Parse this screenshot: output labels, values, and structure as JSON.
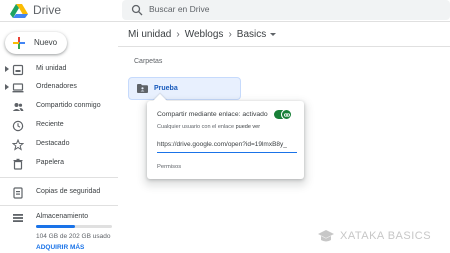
{
  "app": {
    "name": "Drive"
  },
  "search": {
    "placeholder": "Buscar en Drive"
  },
  "sidebar": {
    "new_label": "Nuevo",
    "items": [
      {
        "label": "Mi unidad",
        "icon": "drive-icon"
      },
      {
        "label": "Ordenadores",
        "icon": "computer-icon"
      },
      {
        "label": "Compartido conmigo",
        "icon": "people-icon"
      },
      {
        "label": "Reciente",
        "icon": "clock-icon"
      },
      {
        "label": "Destacado",
        "icon": "star-icon"
      },
      {
        "label": "Papelera",
        "icon": "trash-icon"
      },
      {
        "label": "Copias de seguridad",
        "icon": "backup-icon"
      },
      {
        "label": "Almacenamiento",
        "icon": "storage-icon"
      }
    ],
    "storage": {
      "usage_text": "104 GB de 202 GB usado",
      "used_fraction": 0.515,
      "link": "ADQUIRIR MÁS"
    }
  },
  "breadcrumb": [
    "Mi unidad",
    "Weblogs",
    "Basics"
  ],
  "section": {
    "title": "Carpetas"
  },
  "folder": {
    "name": "Prueba"
  },
  "share_popup": {
    "title": "Compartir mediante enlace: activado",
    "sub_prefix": "Cualquier usuario con el enlace",
    "sub_permission": "puede ver",
    "url": "https://drive.google.com/open?id=19lmxB8y_",
    "permissions_label": "Permisos",
    "toggle_on": true
  },
  "watermark": {
    "text": "XATAKA BASICS"
  },
  "colors": {
    "accent": "#1a73e8",
    "toggle": "#188038",
    "folder_bg": "#e8f0fe"
  }
}
